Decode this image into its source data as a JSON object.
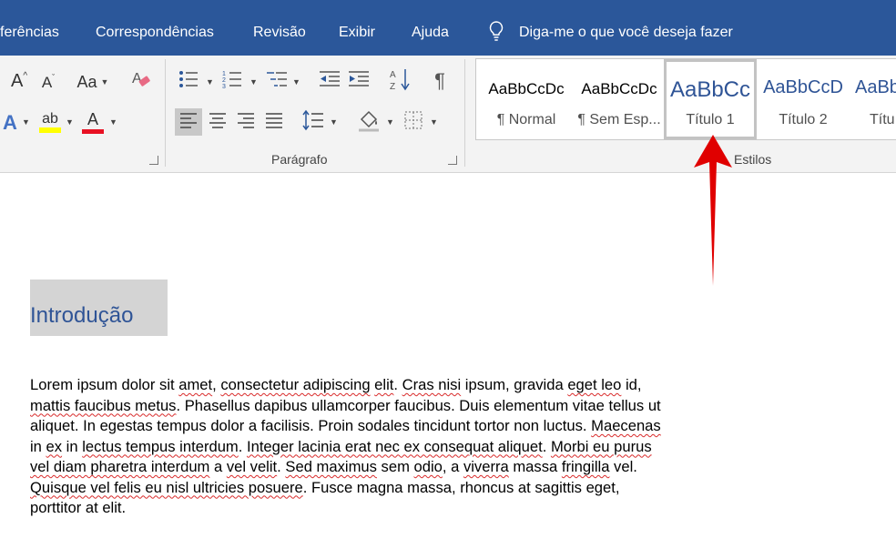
{
  "tabs": [
    "ferências",
    "Correspondências",
    "Revisão",
    "Exibir",
    "Ajuda"
  ],
  "tell_me": "Diga-me o que você deseja fazer",
  "font_group": {
    "grow_label": "A",
    "shrink_label": "A",
    "case_label": "Aa",
    "text_effects_label": "A",
    "highlight_label": "ab",
    "font_color_label": "A",
    "highlight_color": "#ffff00",
    "font_color": "#e81123"
  },
  "paragraph_group": {
    "label": "Parágrafo"
  },
  "styles_group": {
    "label": "Estilos",
    "items": [
      {
        "preview": "AaBbCcDc",
        "name": "¶ Normal"
      },
      {
        "preview": "AaBbCcDc",
        "name": "¶ Sem Esp..."
      },
      {
        "preview": "AaBbCc",
        "name": "Título 1"
      },
      {
        "preview": "AaBbCcD",
        "name": "Título 2"
      },
      {
        "preview": "AaBb",
        "name": "Títu"
      }
    ]
  },
  "document": {
    "heading": "Introdução",
    "paragraph_lines": [
      [
        {
          "t": "Lorem ipsum dolor sit "
        },
        {
          "t": "amet",
          "s": 1
        },
        {
          "t": ", "
        },
        {
          "t": "consectetur adipiscing",
          "s": 1
        },
        {
          "t": " "
        },
        {
          "t": "elit",
          "s": 1
        },
        {
          "t": ". "
        },
        {
          "t": "Cras nisi",
          "s": 1
        },
        {
          "t": " ipsum, gravida "
        },
        {
          "t": "eget leo",
          "s": 1
        },
        {
          "t": " id,"
        }
      ],
      [
        {
          "t": "mattis faucibus metus",
          "s": 1
        },
        {
          "t": ". Phasellus dapibus ullamcorper faucibus. Duis elementum vitae tellus ut"
        }
      ],
      [
        {
          "t": "aliquet. In egestas tempus dolor a facilisis. Proin sodales tincidunt tortor non luctus. "
        },
        {
          "t": "Maecenas",
          "s": 1
        }
      ],
      [
        {
          "t": "in "
        },
        {
          "t": "ex",
          "s": 1
        },
        {
          "t": " in "
        },
        {
          "t": "lectus tempus interdum",
          "s": 1
        },
        {
          "t": ". "
        },
        {
          "t": "Integer lacinia erat nec ex consequat aliquet",
          "s": 1
        },
        {
          "t": ". "
        },
        {
          "t": "Morbi eu purus",
          "s": 1
        }
      ],
      [
        {
          "t": "vel diam pharetra interdum",
          "s": 1
        },
        {
          "t": " a "
        },
        {
          "t": "vel velit",
          "s": 1
        },
        {
          "t": ". "
        },
        {
          "t": "Sed maximus",
          "s": 1
        },
        {
          "t": " sem "
        },
        {
          "t": "odio",
          "s": 1
        },
        {
          "t": ", a "
        },
        {
          "t": "viverra",
          "s": 1
        },
        {
          "t": " massa "
        },
        {
          "t": "fringilla",
          "s": 1
        },
        {
          "t": " vel."
        }
      ],
      [
        {
          "t": "Quisque vel felis eu nisl ultricies posuere",
          "s": 1
        },
        {
          "t": ". Fusce magna massa, rhoncus at sagittis eget,"
        }
      ],
      [
        {
          "t": "porttitor at elit."
        }
      ]
    ]
  },
  "annotation": {
    "arrow_color": "#e00000"
  }
}
